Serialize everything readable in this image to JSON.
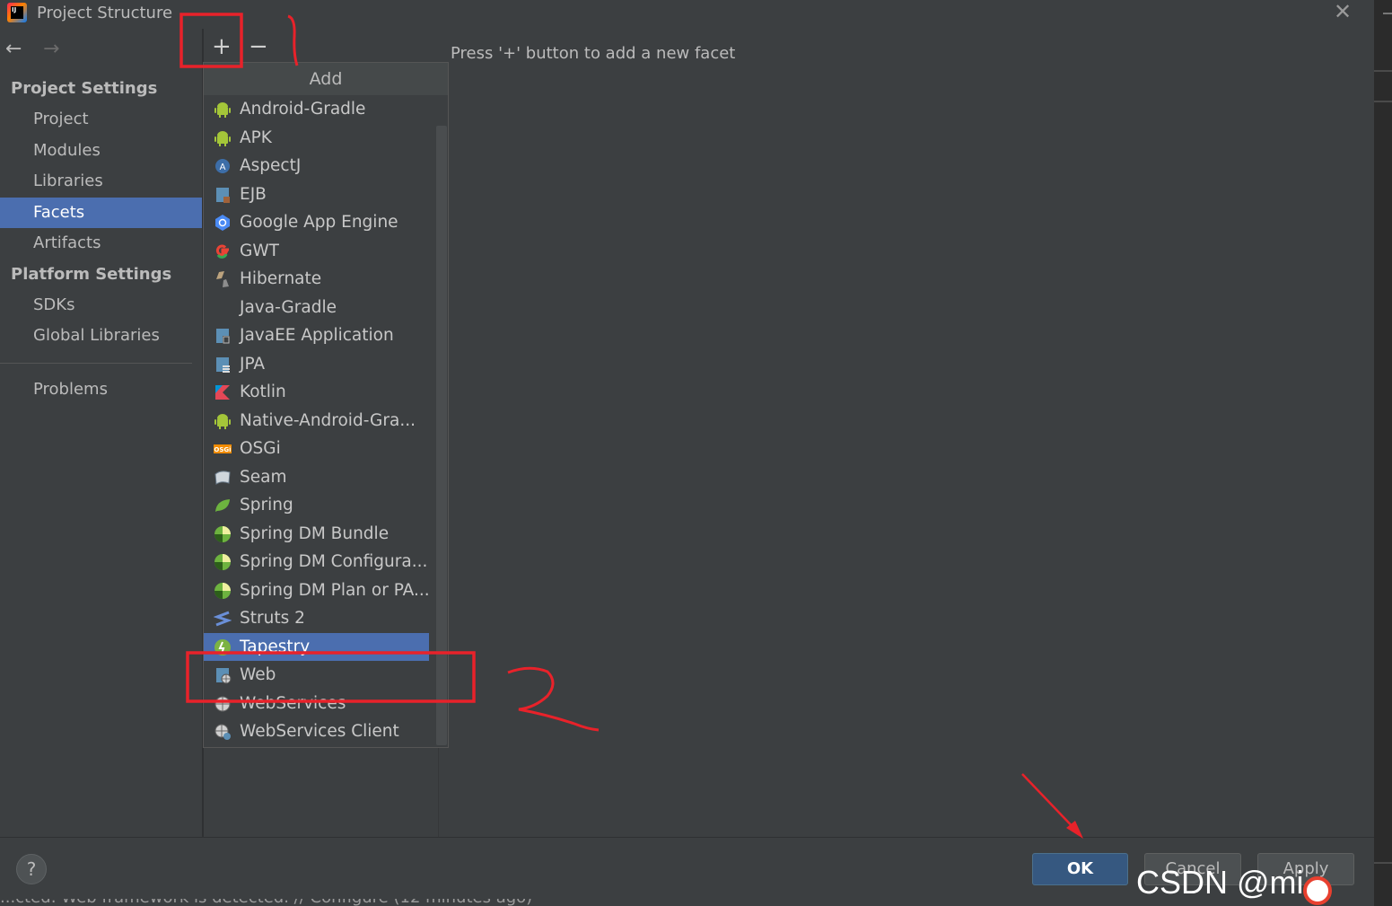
{
  "window": {
    "title": "Project Structure",
    "logo_text": "IJ",
    "close_glyph": "✕"
  },
  "nav": {
    "back_glyph": "←",
    "forward_glyph": "→"
  },
  "sidebar": {
    "project_settings_header": "Project Settings",
    "project_items": [
      {
        "label": "Project"
      },
      {
        "label": "Modules"
      },
      {
        "label": "Libraries"
      },
      {
        "label": "Facets",
        "selected": true
      },
      {
        "label": "Artifacts"
      }
    ],
    "platform_settings_header": "Platform Settings",
    "platform_items": [
      {
        "label": "SDKs"
      },
      {
        "label": "Global Libraries"
      }
    ],
    "problems_label": "Problems"
  },
  "toolbar": {
    "add_glyph": "+",
    "remove_glyph": "−"
  },
  "main": {
    "hint": "Press '+' button to add a new facet"
  },
  "popup": {
    "header": "Add",
    "items": [
      {
        "label": "Android-Gradle",
        "icon": "android-icon"
      },
      {
        "label": "APK",
        "icon": "android-icon"
      },
      {
        "label": "AspectJ",
        "icon": "aspectj-icon"
      },
      {
        "label": "EJB",
        "icon": "ejb-icon"
      },
      {
        "label": "Google App Engine",
        "icon": "app-engine-icon"
      },
      {
        "label": "GWT",
        "icon": "gwt-icon"
      },
      {
        "label": "Hibernate",
        "icon": "hibernate-icon"
      },
      {
        "label": "Java-Gradle",
        "icon": "none"
      },
      {
        "label": "JavaEE Application",
        "icon": "javaee-icon"
      },
      {
        "label": "JPA",
        "icon": "jpa-icon"
      },
      {
        "label": "Kotlin",
        "icon": "kotlin-icon"
      },
      {
        "label": "Native-Android-Gra...",
        "icon": "android-icon"
      },
      {
        "label": "OSGi",
        "icon": "osgi-icon"
      },
      {
        "label": "Seam",
        "icon": "seam-icon"
      },
      {
        "label": "Spring",
        "icon": "spring-icon"
      },
      {
        "label": "Spring DM Bundle",
        "icon": "spring-dm-icon"
      },
      {
        "label": "Spring DM Configura...",
        "icon": "spring-dm-icon"
      },
      {
        "label": "Spring DM Plan or PA...",
        "icon": "spring-dm-icon"
      },
      {
        "label": "Struts 2",
        "icon": "struts-icon"
      },
      {
        "label": "Tapestry",
        "icon": "tapestry-icon",
        "selected": true
      },
      {
        "label": "Web",
        "icon": "web-icon"
      },
      {
        "label": "WebServices",
        "icon": "webservices-icon"
      },
      {
        "label": "WebServices Client",
        "icon": "webservices-client-icon"
      }
    ]
  },
  "footer": {
    "help_glyph": "?",
    "ok_label": "OK",
    "cancel_label": "Cancel",
    "apply_label": "Apply",
    "status_text": "...cted: Web framework is detected. // Configure (12 minutes ago)"
  },
  "watermark": {
    "text": "CSDN @mi..."
  },
  "annotations": {
    "step1": "1",
    "step2": "2",
    "color": "#e8222a"
  },
  "colors": {
    "accent": "#4b6eaf",
    "ok_button": "#365880",
    "background": "#3c3f41"
  }
}
